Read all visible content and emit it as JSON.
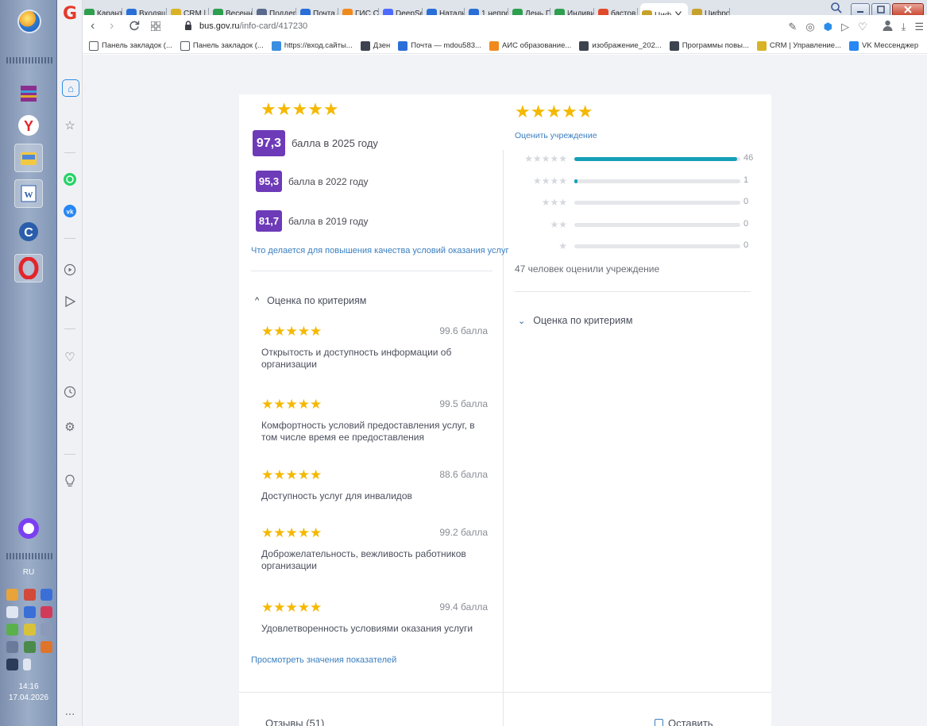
{
  "taskbar": {
    "lang": "RU",
    "time": "14:16",
    "date": "17.04.2026",
    "more": "..."
  },
  "browser": {
    "tabs": [
      {
        "label": "Каранти",
        "color": "#2e9e4f"
      },
      {
        "label": "Входящ",
        "color": "#2a6fd8"
      },
      {
        "label": "CRM | У",
        "color": "#d8b326"
      },
      {
        "label": "Весенн",
        "color": "#2e9e4f"
      },
      {
        "label": "Поддер",
        "color": "#5a6b8c"
      },
      {
        "label": "Почта —",
        "color": "#2a6fd8"
      },
      {
        "label": "ГИС СО",
        "color": "#f08a1c"
      },
      {
        "label": "DeepSee",
        "color": "#4d6bfe"
      },
      {
        "label": "Натальи",
        "color": "#2a6fd8"
      },
      {
        "label": "1 непро",
        "color": "#2a6fd8"
      },
      {
        "label": "День По",
        "color": "#2e9e4f"
      },
      {
        "label": "Индиви",
        "color": "#2e9e4f"
      },
      {
        "label": "бастов",
        "color": "#e04a2a"
      },
      {
        "label": "Циф",
        "color": "#c7a22a"
      },
      {
        "label": "Цифров",
        "color": "#c7a22a"
      }
    ],
    "active_tab_index": 13,
    "tab_close": "X",
    "new_tab": "+",
    "url_host": "bus.gov.ru",
    "url_path": "/info-card/417230",
    "bookmarks": [
      {
        "label": "Панель закладок (...",
        "icon": "folder-icon"
      },
      {
        "label": "Панель закладок (...",
        "icon": "folder-icon"
      },
      {
        "label": "https://вход.сайты...",
        "icon": "globe-icon"
      },
      {
        "label": "Дзен",
        "icon": "doc-icon"
      },
      {
        "label": "Почта — mdou583...",
        "icon": "mail-icon"
      },
      {
        "label": "АИС образование...",
        "icon": "ais-icon"
      },
      {
        "label": "изображение_202...",
        "icon": "doc-icon"
      },
      {
        "label": "Программы повы...",
        "icon": "program-icon"
      },
      {
        "label": "CRM | Управление...",
        "icon": "crm-icon"
      },
      {
        "label": "VK Мессенджер",
        "icon": "vk-icon"
      }
    ]
  },
  "left_panel": {
    "scores": [
      {
        "value": "97,3",
        "text": "балла в 2025 году"
      },
      {
        "value": "95,3",
        "text": "балла в 2022 году"
      },
      {
        "value": "81,7",
        "text": "балла в 2019 году"
      }
    ],
    "improve_link": "Что делается для повышения качества условий оказания услуг",
    "criteria_header": "Оценка по критериям",
    "criteria": [
      {
        "points": "99.6 балла",
        "label": "Открытость и доступность информации об организации"
      },
      {
        "points": "99.5 балла",
        "label": "Комфортность условий предоставления услуг, в том числе время ее предоставления"
      },
      {
        "points": "88.6 балла",
        "label": "Доступность услуг для инвалидов"
      },
      {
        "points": "99.2 балла",
        "label": "Доброжелательность, вежливость работников организации"
      },
      {
        "points": "99.4 балла",
        "label": "Удовлетворенность условиями оказания услуги"
      }
    ],
    "view_link": "Просмотреть значения показателей"
  },
  "right_panel": {
    "rate_link": "Оценить учреждение",
    "distribution": [
      {
        "stars": 5,
        "count": "46",
        "fraction": 0.98
      },
      {
        "stars": 4,
        "count": "1",
        "fraction": 0.02
      },
      {
        "stars": 3,
        "count": "0",
        "fraction": 0
      },
      {
        "stars": 2,
        "count": "0",
        "fraction": 0
      },
      {
        "stars": 1,
        "count": "0",
        "fraction": 0
      }
    ],
    "rated_text": "47 человек оценили учреждение",
    "criteria_header": "Оценка по критериям"
  },
  "bottom": {
    "reviews_label": "Отзывы (51)",
    "right_label": "Оставить отзыв"
  },
  "colors": {
    "star": "#f5b800",
    "badge": "#6d3ab8",
    "bar": "#14a1b6",
    "link": "#3b7fbf"
  }
}
